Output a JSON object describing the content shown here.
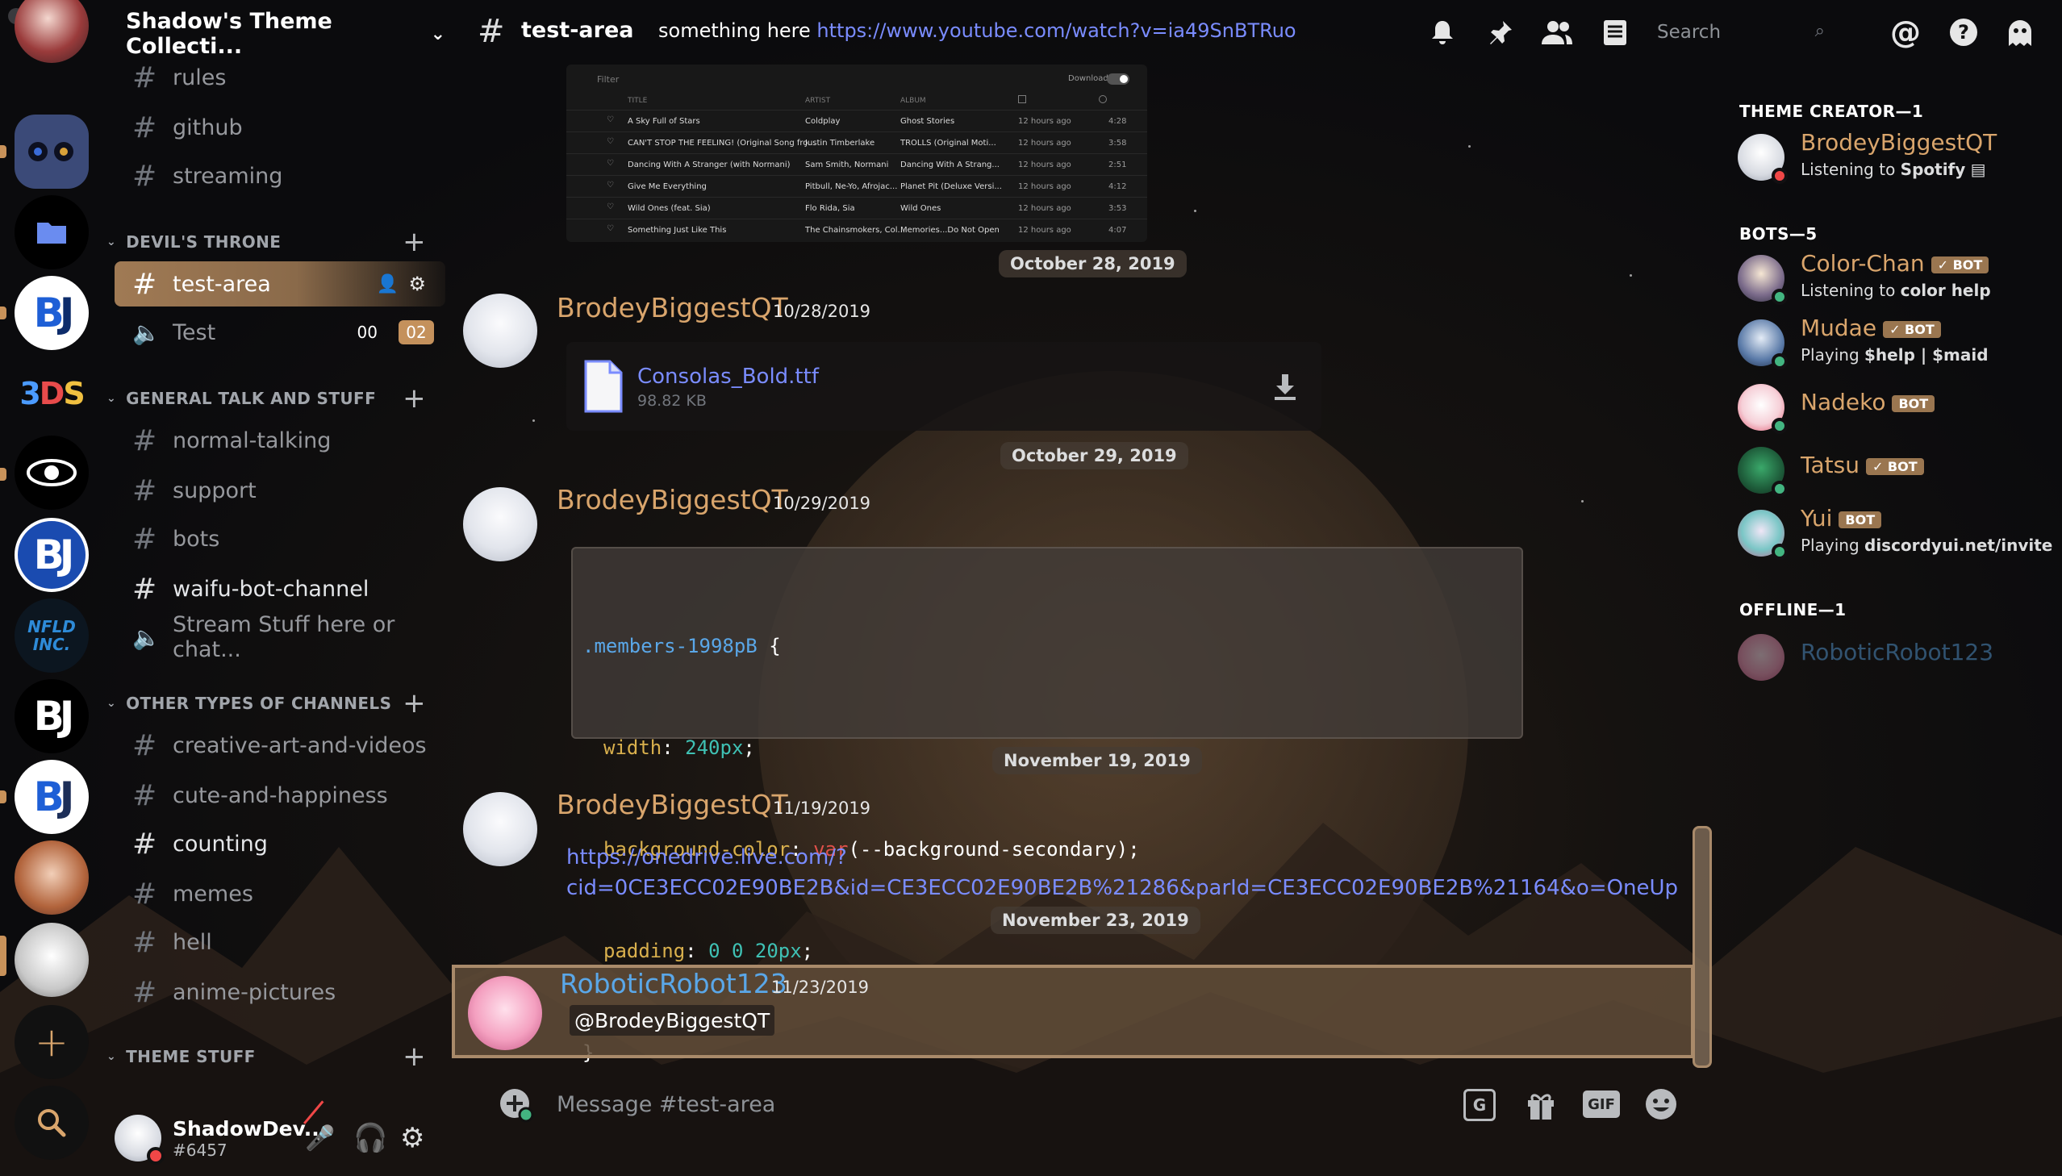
{
  "guild": {
    "name": "Shadow's Theme Collecti..."
  },
  "channels": {
    "top": [
      "rules",
      "github",
      "streaming"
    ],
    "cat1": {
      "name": "DEVIL'S THRONE",
      "items": [
        {
          "name": "test-area"
        },
        {
          "name": "Test",
          "badge_a": "00",
          "badge_b": "02"
        }
      ]
    },
    "cat2": {
      "name": "GENERAL TALK AND STUFF",
      "items": [
        "normal-talking",
        "support",
        "bots",
        "waifu-bot-channel",
        "Stream Stuff here or chat..."
      ]
    },
    "cat3": {
      "name": "OTHER TYPES OF CHANNELS",
      "items": [
        "creative-art-and-videos",
        "cute-and-happiness",
        "counting",
        "memes",
        "hell",
        "anime-pictures"
      ]
    },
    "cat4": {
      "name": "THEME STUFF"
    }
  },
  "user": {
    "name": "ShadowDev...",
    "tag": "#6457"
  },
  "topbar": {
    "channel": "test-area",
    "topic_text": "something here ",
    "topic_link": "https://www.youtube.com/watch?v=ia49SnBTRuo",
    "search_placeholder": "Search"
  },
  "spotify": {
    "filter": "Filter",
    "download": "Download",
    "headers": [
      "TITLE",
      "ARTIST",
      "ALBUM"
    ],
    "rows": [
      [
        "A Sky Full of Stars",
        "Coldplay",
        "Ghost Stories",
        "12 hours ago",
        "4:28"
      ],
      [
        "CAN'T STOP THE FEELING! (Original Song fro...",
        "Justin Timberlake",
        "TROLLS (Original Moti...",
        "12 hours ago",
        "3:58"
      ],
      [
        "Dancing With A Stranger (with Normani)",
        "Sam Smith, Normani",
        "Dancing With A Strang...",
        "12 hours ago",
        "2:51"
      ],
      [
        "Give Me Everything",
        "Pitbull, Ne-Yo, Afrojac...",
        "Planet Pit (Deluxe Versi...",
        "12 hours ago",
        "4:12"
      ],
      [
        "Wild Ones (feat. Sia)",
        "Flo Rida, Sia",
        "Wild Ones",
        "12 hours ago",
        "3:53"
      ],
      [
        "Something Just Like This",
        "The Chainsmokers, Col...",
        "Memories...Do Not Open",
        "12 hours ago",
        "4:07"
      ]
    ]
  },
  "dividers": [
    "October 28, 2019",
    "October 29, 2019",
    "November 19, 2019",
    "November 23, 2019"
  ],
  "messages": [
    {
      "author": "BrodeyBiggestQT",
      "time": "10/28/2019",
      "file_name": "Consolas_Bold.ttf",
      "file_size": "98.82 KB"
    },
    {
      "author": "BrodeyBiggestQT",
      "time": "10/29/2019",
      "code": {
        "l1_sel": ".members-1998pB",
        "l1_brace": " {",
        "l2_prop": "width",
        "l2_val": "240px",
        "l3_prop": "background-color",
        "l3_fn": "var",
        "l3_arg": "(--background-secondary);",
        "l4_prop": "padding",
        "l4_v1": "0",
        "l4_v2": "0",
        "l4_v3": "20px",
        "l5": "}"
      }
    },
    {
      "author": "BrodeyBiggestQT",
      "time": "11/19/2019",
      "link_line1": "https://onedrive.live.com/?",
      "link_line2": "cid=0CE3ECC02E90BE2B&id=CE3ECC02E90BE2B%21286&parId=CE3ECC02E90BE2B%21164&o=OneUp"
    },
    {
      "author": "RoboticRobot123",
      "time": "11/23/2019",
      "mention": "@BrodeyBiggestQT"
    }
  ],
  "composer": {
    "placeholder": "Message #test-area",
    "gif": "GIF"
  },
  "members": {
    "creator_header": "THEME CREATOR—1",
    "creator": {
      "name": "BrodeyBiggestQT",
      "status_pre": "Listening to ",
      "status_bold": "Spotify"
    },
    "bots_header": "BOTS—5",
    "bots": [
      {
        "name": "Color-Chan",
        "badge": "✓ BOT",
        "status_pre": "Listening to ",
        "status_bold": "color help"
      },
      {
        "name": "Mudae",
        "badge": "✓ BOT",
        "status_pre": "Playing ",
        "status_bold": "$help | $maid"
      },
      {
        "name": "Nadeko",
        "badge": "BOT"
      },
      {
        "name": "Tatsu",
        "badge": "✓ BOT"
      },
      {
        "name": "Yui",
        "badge": "BOT",
        "status_pre": "Playing ",
        "status_bold": "discordyui.net/invite"
      }
    ],
    "offline_header": "OFFLINE—1",
    "offline": {
      "name": "RoboticRobot123"
    }
  },
  "colors": {
    "accent": "#d9a56c",
    "link": "#7a8cff",
    "active_channel": "#a07a54"
  },
  "icons": [
    "bell-icon",
    "pin-icon",
    "members-icon",
    "inbox-icon",
    "search-icon",
    "mention-icon",
    "help-icon",
    "ghost-icon",
    "home-folder-icon",
    "add-server-icon",
    "explore-icon",
    "mute-icon",
    "headphones-icon",
    "settings-icon",
    "upload-icon",
    "translate-icon",
    "gift-icon",
    "emoji-icon",
    "file-icon",
    "download-icon"
  ]
}
